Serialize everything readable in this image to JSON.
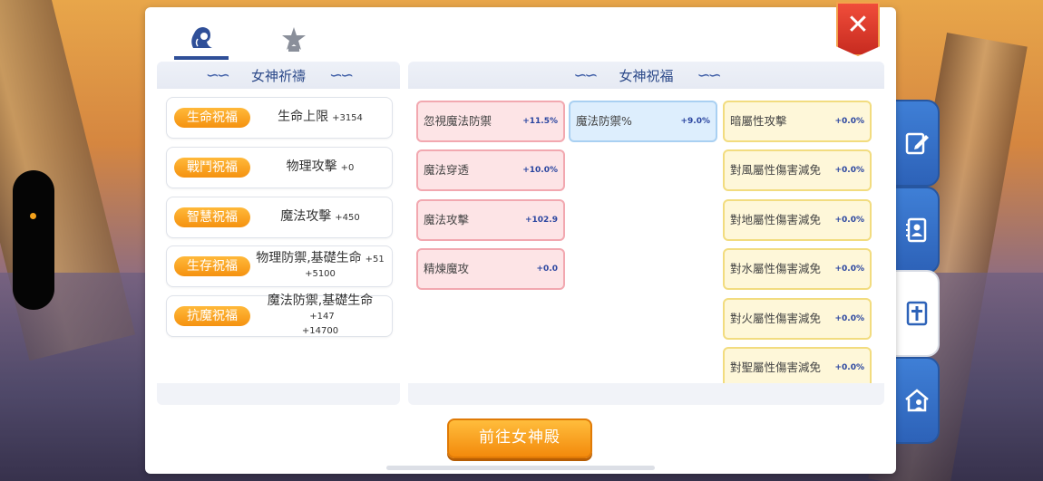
{
  "window": {
    "close_label": "✕"
  },
  "top_tabs": [
    {
      "icon": "goddess-head-icon",
      "active": true
    },
    {
      "icon": "star-emblem-icon",
      "active": false
    }
  ],
  "left_panel": {
    "title": "女神祈禱",
    "rows": [
      {
        "badge": "生命祝福",
        "stat": "生命上限",
        "value": "+3154",
        "value2": ""
      },
      {
        "badge": "戰鬥祝福",
        "stat": "物理攻擊",
        "value": "+0",
        "value2": ""
      },
      {
        "badge": "智慧祝福",
        "stat": "魔法攻擊",
        "value": "+450",
        "value2": ""
      },
      {
        "badge": "生存祝福",
        "stat": "物理防禦,基礎生命",
        "value": "+51",
        "value2": "+5100"
      },
      {
        "badge": "抗魔祝福",
        "stat": "魔法防禦,基礎生命",
        "value": "+147",
        "value2": "+14700"
      }
    ]
  },
  "right_panel": {
    "title": "女神祝福",
    "col1": [
      {
        "name": "忽視魔法防禦",
        "value": "+11.5%"
      },
      {
        "name": "魔法穿透",
        "value": "+10.0%"
      },
      {
        "name": "魔法攻擊",
        "value": "+102.9"
      },
      {
        "name": "精煉魔攻",
        "value": "+0.0"
      }
    ],
    "col2": [
      {
        "name": "魔法防禦%",
        "value": "+9.0%"
      }
    ],
    "col3": [
      {
        "name": "暗屬性攻擊",
        "value": "+0.0%"
      },
      {
        "name": "對風屬性傷害減免",
        "value": "+0.0%"
      },
      {
        "name": "對地屬性傷害減免",
        "value": "+0.0%"
      },
      {
        "name": "對水屬性傷害減免",
        "value": "+0.0%"
      },
      {
        "name": "對火屬性傷害減免",
        "value": "+0.0%"
      },
      {
        "name": "對聖屬性傷害減免",
        "value": "+0.0%"
      }
    ]
  },
  "goto_button": "前往女神殿",
  "side_tabs": [
    {
      "icon": "edit-note-icon",
      "active": false
    },
    {
      "icon": "contact-book-icon",
      "active": false
    },
    {
      "icon": "holy-cross-icon",
      "active": true
    },
    {
      "icon": "guild-house-icon",
      "active": false
    }
  ],
  "colors": {
    "badge": "#f59210",
    "accent_blue": "#2f4f98",
    "card_pink": "#fde4e6",
    "card_blue": "#ddeefd",
    "card_yellow": "#fef7d9",
    "close_red": "#e0392a"
  }
}
